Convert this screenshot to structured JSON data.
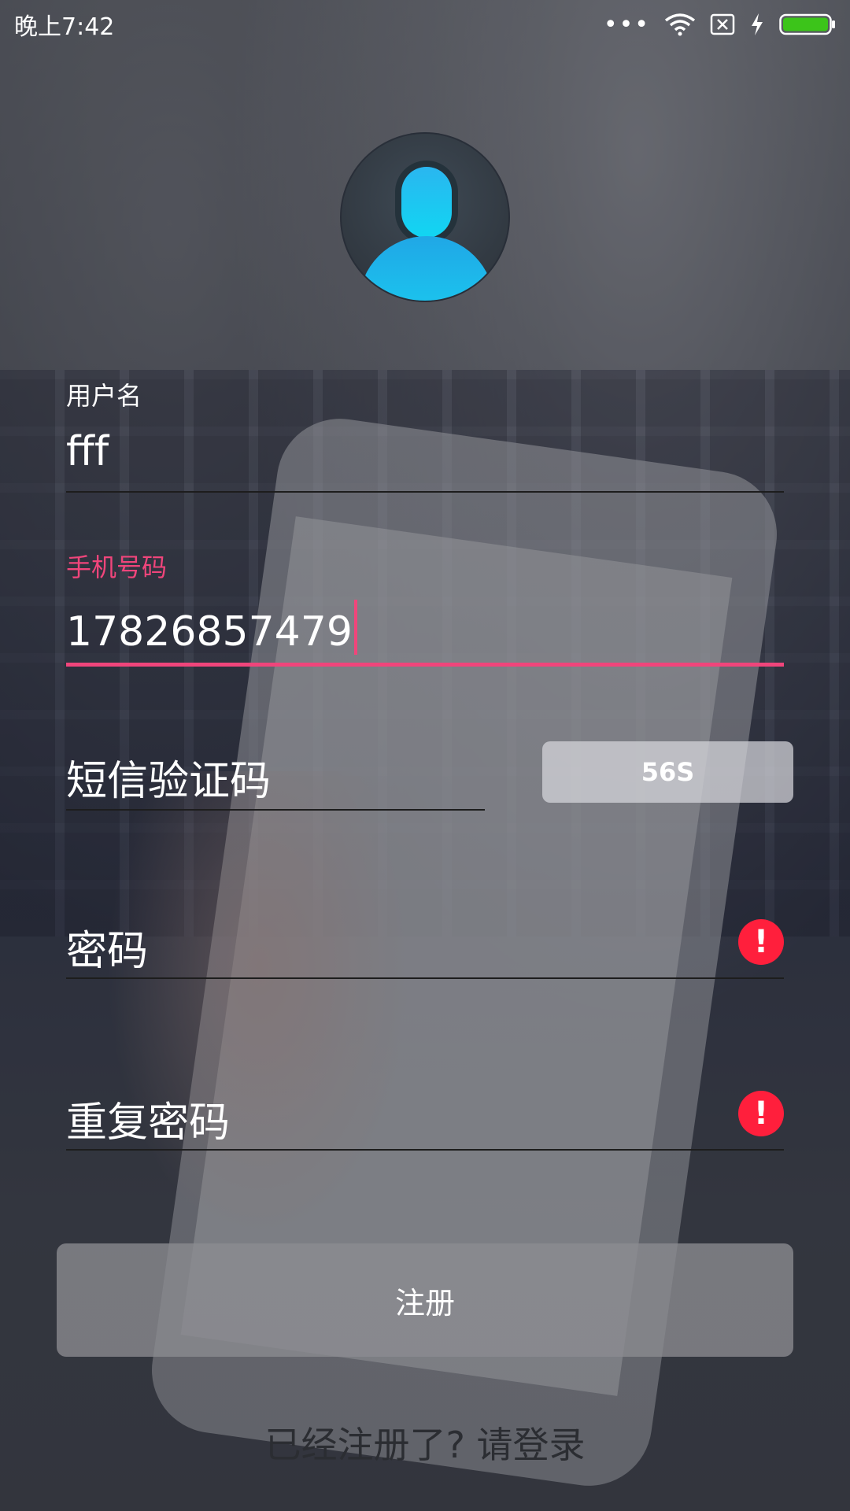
{
  "status_bar": {
    "time": "晚上7:42",
    "more": "•••",
    "icons": [
      "wifi-icon",
      "sim-off-icon",
      "charging-bolt-icon",
      "battery-icon"
    ],
    "battery_color": "#3cc41a"
  },
  "avatar": {
    "icon": "user-avatar-icon"
  },
  "form": {
    "username": {
      "label": "用户名",
      "value": "fff"
    },
    "phone": {
      "label": "手机号码",
      "value": "17826857479"
    },
    "sms_code": {
      "placeholder": "短信验证码",
      "button_label": "56S"
    },
    "password": {
      "placeholder": "密码",
      "error_icon": "!"
    },
    "repeat_password": {
      "placeholder": "重复密码",
      "error_icon": "!"
    }
  },
  "actions": {
    "register_label": "注册",
    "login_link": "已经注册了? 请登录"
  },
  "colors": {
    "accent": "#f0457b",
    "error": "#ff1f3c"
  }
}
